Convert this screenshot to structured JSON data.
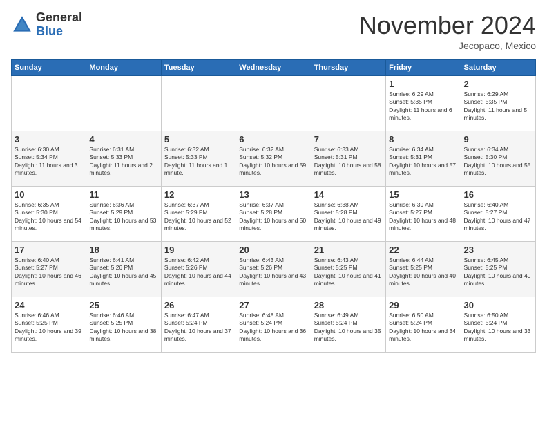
{
  "logo": {
    "general": "General",
    "blue": "Blue"
  },
  "title": "November 2024",
  "location": "Jecopaco, Mexico",
  "days_of_week": [
    "Sunday",
    "Monday",
    "Tuesday",
    "Wednesday",
    "Thursday",
    "Friday",
    "Saturday"
  ],
  "weeks": [
    [
      {
        "day": "",
        "info": ""
      },
      {
        "day": "",
        "info": ""
      },
      {
        "day": "",
        "info": ""
      },
      {
        "day": "",
        "info": ""
      },
      {
        "day": "",
        "info": ""
      },
      {
        "day": "1",
        "info": "Sunrise: 6:29 AM\nSunset: 5:35 PM\nDaylight: 11 hours and 6 minutes."
      },
      {
        "day": "2",
        "info": "Sunrise: 6:29 AM\nSunset: 5:35 PM\nDaylight: 11 hours and 5 minutes."
      }
    ],
    [
      {
        "day": "3",
        "info": "Sunrise: 6:30 AM\nSunset: 5:34 PM\nDaylight: 11 hours and 3 minutes."
      },
      {
        "day": "4",
        "info": "Sunrise: 6:31 AM\nSunset: 5:33 PM\nDaylight: 11 hours and 2 minutes."
      },
      {
        "day": "5",
        "info": "Sunrise: 6:32 AM\nSunset: 5:33 PM\nDaylight: 11 hours and 1 minute."
      },
      {
        "day": "6",
        "info": "Sunrise: 6:32 AM\nSunset: 5:32 PM\nDaylight: 10 hours and 59 minutes."
      },
      {
        "day": "7",
        "info": "Sunrise: 6:33 AM\nSunset: 5:31 PM\nDaylight: 10 hours and 58 minutes."
      },
      {
        "day": "8",
        "info": "Sunrise: 6:34 AM\nSunset: 5:31 PM\nDaylight: 10 hours and 57 minutes."
      },
      {
        "day": "9",
        "info": "Sunrise: 6:34 AM\nSunset: 5:30 PM\nDaylight: 10 hours and 55 minutes."
      }
    ],
    [
      {
        "day": "10",
        "info": "Sunrise: 6:35 AM\nSunset: 5:30 PM\nDaylight: 10 hours and 54 minutes."
      },
      {
        "day": "11",
        "info": "Sunrise: 6:36 AM\nSunset: 5:29 PM\nDaylight: 10 hours and 53 minutes."
      },
      {
        "day": "12",
        "info": "Sunrise: 6:37 AM\nSunset: 5:29 PM\nDaylight: 10 hours and 52 minutes."
      },
      {
        "day": "13",
        "info": "Sunrise: 6:37 AM\nSunset: 5:28 PM\nDaylight: 10 hours and 50 minutes."
      },
      {
        "day": "14",
        "info": "Sunrise: 6:38 AM\nSunset: 5:28 PM\nDaylight: 10 hours and 49 minutes."
      },
      {
        "day": "15",
        "info": "Sunrise: 6:39 AM\nSunset: 5:27 PM\nDaylight: 10 hours and 48 minutes."
      },
      {
        "day": "16",
        "info": "Sunrise: 6:40 AM\nSunset: 5:27 PM\nDaylight: 10 hours and 47 minutes."
      }
    ],
    [
      {
        "day": "17",
        "info": "Sunrise: 6:40 AM\nSunset: 5:27 PM\nDaylight: 10 hours and 46 minutes."
      },
      {
        "day": "18",
        "info": "Sunrise: 6:41 AM\nSunset: 5:26 PM\nDaylight: 10 hours and 45 minutes."
      },
      {
        "day": "19",
        "info": "Sunrise: 6:42 AM\nSunset: 5:26 PM\nDaylight: 10 hours and 44 minutes."
      },
      {
        "day": "20",
        "info": "Sunrise: 6:43 AM\nSunset: 5:26 PM\nDaylight: 10 hours and 43 minutes."
      },
      {
        "day": "21",
        "info": "Sunrise: 6:43 AM\nSunset: 5:25 PM\nDaylight: 10 hours and 41 minutes."
      },
      {
        "day": "22",
        "info": "Sunrise: 6:44 AM\nSunset: 5:25 PM\nDaylight: 10 hours and 40 minutes."
      },
      {
        "day": "23",
        "info": "Sunrise: 6:45 AM\nSunset: 5:25 PM\nDaylight: 10 hours and 40 minutes."
      }
    ],
    [
      {
        "day": "24",
        "info": "Sunrise: 6:46 AM\nSunset: 5:25 PM\nDaylight: 10 hours and 39 minutes."
      },
      {
        "day": "25",
        "info": "Sunrise: 6:46 AM\nSunset: 5:25 PM\nDaylight: 10 hours and 38 minutes."
      },
      {
        "day": "26",
        "info": "Sunrise: 6:47 AM\nSunset: 5:24 PM\nDaylight: 10 hours and 37 minutes."
      },
      {
        "day": "27",
        "info": "Sunrise: 6:48 AM\nSunset: 5:24 PM\nDaylight: 10 hours and 36 minutes."
      },
      {
        "day": "28",
        "info": "Sunrise: 6:49 AM\nSunset: 5:24 PM\nDaylight: 10 hours and 35 minutes."
      },
      {
        "day": "29",
        "info": "Sunrise: 6:50 AM\nSunset: 5:24 PM\nDaylight: 10 hours and 34 minutes."
      },
      {
        "day": "30",
        "info": "Sunrise: 6:50 AM\nSunset: 5:24 PM\nDaylight: 10 hours and 33 minutes."
      }
    ]
  ]
}
